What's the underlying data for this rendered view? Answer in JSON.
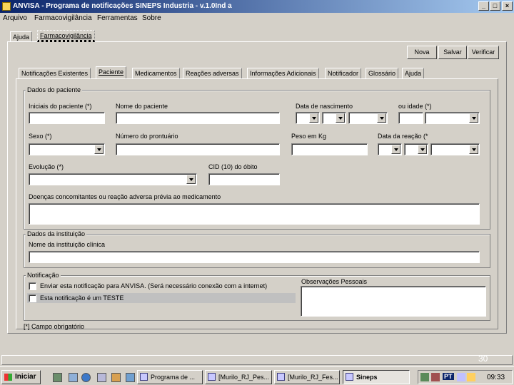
{
  "window": {
    "title": "ANVISA - Programa de notificações SINEPS Industria - v.1.0Ind a",
    "buttons": {
      "minimize": "_",
      "maximize": "□",
      "close": "×"
    }
  },
  "menu": [
    "Arquivo",
    "Farmacovigilância",
    "Ferramentas",
    "Sobre"
  ],
  "outer_tabs": [
    "Ajuda",
    "Farmacovigilância"
  ],
  "toolbar": {
    "new": "Nova",
    "save": "Salvar",
    "verify": "Verificar"
  },
  "inner_tabs": [
    "Notificações Existentes",
    "Paciente",
    "Medicamentos",
    "Reações adversas",
    "Informações Adicionais",
    "Notificador",
    "Glossário",
    "Ajuda"
  ],
  "patient": {
    "legend": "Dados do paciente",
    "initials_label": "Iniciais do paciente (*)",
    "name_label": "Nome do paciente",
    "birth_label": "Data de nascimento",
    "age_label": "ou idade (*)",
    "sex_label": "Sexo (*)",
    "record_label": "Número do prontuário",
    "weight_label": "Peso em Kg",
    "reaction_date_label": "Data da reação (*",
    "evolution_label": "Evolução (*)",
    "cid_label": "CID (10) do óbito",
    "diseases_label": "Doenças concomitantes ou reação adversa prévia ao medicamento"
  },
  "institution": {
    "legend": "Dados da instituição",
    "name_label": "Nome da instituição clínica"
  },
  "notification": {
    "legend": "Notificação",
    "send_label": "Enviar esta notificação para ANVISA. (Será necessário conexão com a internet)",
    "test_label": "Esta notificação é um TESTE",
    "notes_label": "Observações Pessoais"
  },
  "footer": {
    "required": "[*] Campo obrigatório",
    "page_number": "30"
  },
  "taskbar": {
    "start": "Iniciar",
    "tasks": [
      "Programa de ...",
      "[Murilo_RJ_Pes...",
      "[Murilo_RJ_Fes...",
      "Sineps"
    ],
    "language": "PT",
    "clock": "09:33"
  }
}
